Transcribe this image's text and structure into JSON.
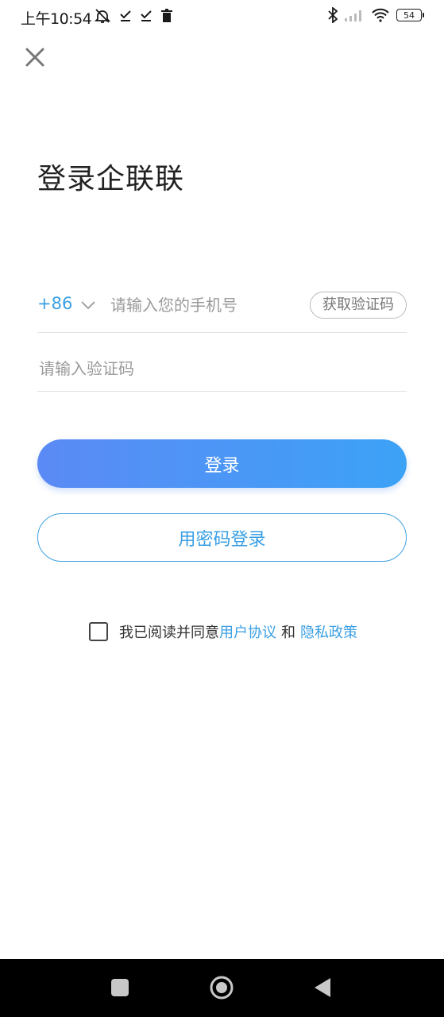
{
  "status_bar": {
    "time": "上午10:54",
    "battery": "54",
    "icons_left": [
      "alarm-off-icon",
      "check-icon",
      "check-icon",
      "trash-icon"
    ],
    "icons_right": [
      "bluetooth-icon",
      "signal-icon",
      "wifi-icon",
      "battery-icon"
    ]
  },
  "header": {
    "close_icon": "close-icon"
  },
  "main": {
    "title": "登录企联联",
    "phone": {
      "country_code": "+86",
      "placeholder": "请输入您的手机号",
      "value": "",
      "get_code_label": "获取验证码"
    },
    "code": {
      "placeholder": "请输入验证码",
      "value": ""
    },
    "login_label": "登录",
    "password_login_label": "用密码登录",
    "agreement": {
      "checked": false,
      "prefix": "我已阅读并同意",
      "user_agreement": "用户协议",
      "and": "和",
      "privacy_policy": "隐私政策"
    }
  },
  "nav_bar": {
    "recent_icon": "recent-apps-icon",
    "home_icon": "home-icon",
    "back_icon": "back-icon"
  },
  "colors": {
    "accent": "#3a9fe3",
    "gradient_start": "#5b8af5",
    "gradient_end": "#3ca2f6",
    "nav_bar": "#000000"
  }
}
